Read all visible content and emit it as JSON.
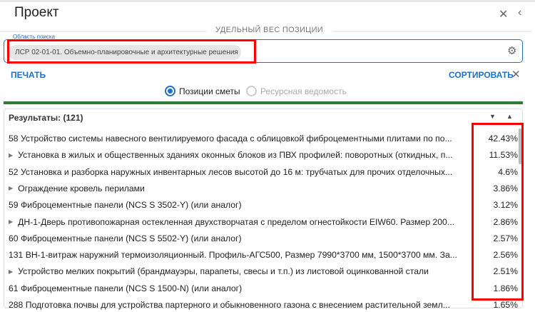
{
  "header": {
    "title": "Проект",
    "section_label": "УДЕЛЬНЫЙ ВЕС ПОЗИЦИИ"
  },
  "search": {
    "label": "Область поиска",
    "chip": "ЛСР 02-01-01. Объемно-планировочные и архитектурные решения"
  },
  "actions": {
    "print": "ПЕЧАТЬ",
    "sort": "СОРТИРОВАТЬ"
  },
  "radios": [
    {
      "label": "Позиции сметы",
      "selected": true
    },
    {
      "label": "Ресурсная ведомость",
      "selected": false
    }
  ],
  "results": {
    "header": "Результаты: (121)",
    "rows": [
      {
        "expandable": false,
        "text": "58 Устройство системы навесного вентилируемого фасада с облицовкой фиброцементными плитами по по...",
        "pct": "42.43%"
      },
      {
        "expandable": true,
        "text": "Установка в жилых и общественных зданиях оконных блоков из ПВХ профилей: поворотных (откидных, п...",
        "pct": "11.53%"
      },
      {
        "expandable": false,
        "text": "52 Установка и разборка наружных инвентарных лесов высотой до 16 м: трубчатых для прочих отделочных...",
        "pct": "4.6%"
      },
      {
        "expandable": true,
        "text": "Ограждение кровель перилами",
        "pct": "3.86%"
      },
      {
        "expandable": false,
        "text": "59 Фиброцементные панели (NCS S 3502-Y) (или аналог)",
        "pct": "3.12%"
      },
      {
        "expandable": true,
        "text": "ДН-1-Дверь противопожарная остекленная двухстворчатая с пределом огнестойкости EIW60. Размер 200...",
        "pct": "2.86%"
      },
      {
        "expandable": false,
        "text": "60 Фиброцементные панели (NCS S 5502-Y) (или аналог)",
        "pct": "2.57%"
      },
      {
        "expandable": false,
        "text": "131 ВН-1-витраж наружний термоизоляционный. Профиль-АГС500, Размер 7990*3700 мм, 1500*3700 мм. За...",
        "pct": "2.56%"
      },
      {
        "expandable": true,
        "text": "Устройство мелких покрытий (брандмауэры, парапеты, свесы и т.п.) из листовой оцинкованной стали",
        "pct": "2.51%"
      },
      {
        "expandable": false,
        "text": "61 Фиброцементные панели (NCS S 1500-N) (или аналог)",
        "pct": "1.86%"
      },
      {
        "expandable": false,
        "text": "288 Подготовка почвы для устройства партерного и обыкновенного газона с внесением растительной земл...",
        "pct": "1.65%"
      }
    ]
  },
  "colors": {
    "accent": "#1e6fd0",
    "green": "#2e7d32",
    "highlight": "#ff0000"
  }
}
